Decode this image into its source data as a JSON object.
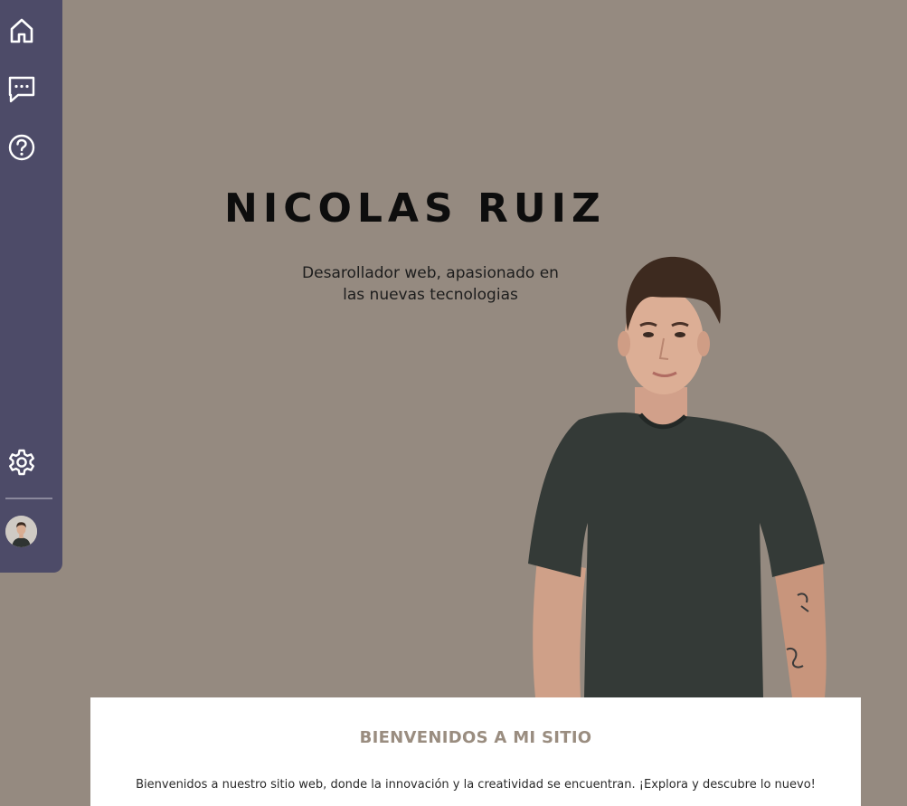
{
  "colors": {
    "background": "#958a80",
    "sidebar": "#4d4b68",
    "card": "#ffffff",
    "welcome_title": "#9a8d80",
    "name": "#0d0d0d"
  },
  "sidebar": {
    "top_items": [
      {
        "icon": "home-icon"
      },
      {
        "icon": "chat-icon"
      },
      {
        "icon": "help-icon"
      }
    ],
    "bottom_items": [
      {
        "icon": "gear-icon"
      }
    ],
    "avatar": "user-avatar"
  },
  "hero": {
    "name": "NICOLAS RUIZ",
    "subtitle_line1": "Desarollador web, apasionado en",
    "subtitle_line2": "las nuevas tecnologias"
  },
  "welcome": {
    "title": "BIENVENIDOS A MI SITIO",
    "text": "Bienvenidos a nuestro sitio web, donde la innovación y la creatividad se encuentran. ¡Explora y descubre lo nuevo!"
  }
}
